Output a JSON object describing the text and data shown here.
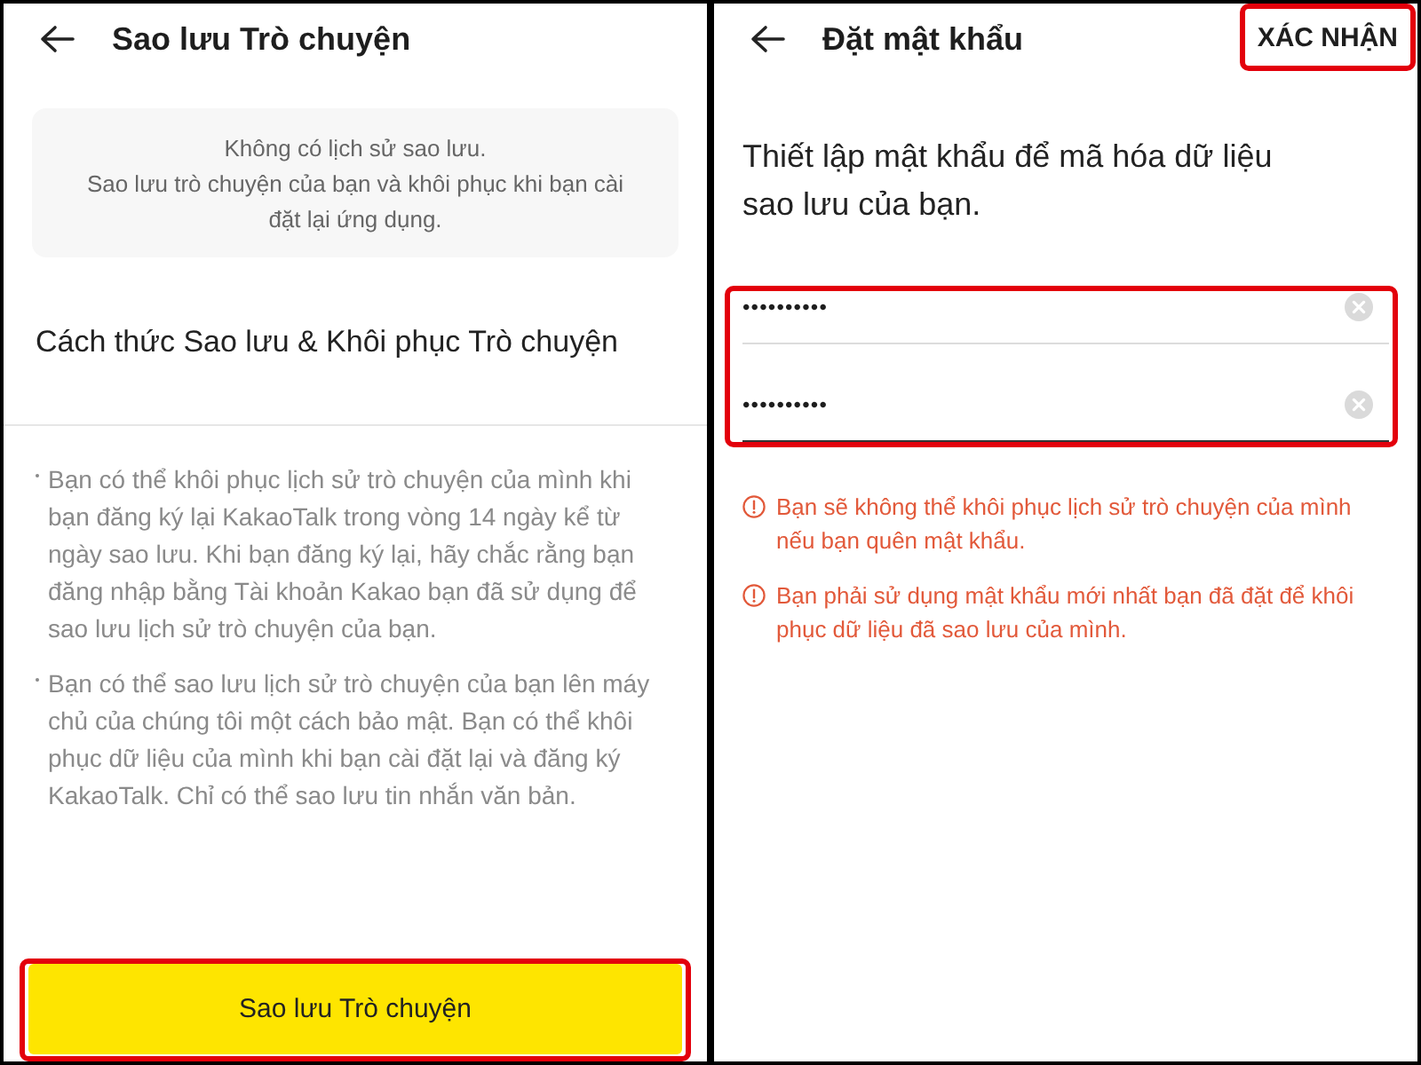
{
  "left_screen": {
    "header": {
      "title": "Sao lưu Trò chuyện"
    },
    "notice": {
      "title": "Không có lịch sử sao lưu.",
      "message": "Sao lưu trò chuyện của bạn và khôi phục khi bạn cài đặt lại ứng dụng."
    },
    "section_title": "Cách thức Sao lưu & Khôi phục Trò chuyện",
    "guide_items": [
      "Bạn có thể khôi phục lịch sử trò chuyện của mình khi bạn đăng ký lại KakaoTalk trong vòng 14 ngày kể từ ngày sao lưu. Khi bạn đăng ký lại, hãy chắc rằng bạn đăng nhập bằng Tài khoản Kakao bạn đã sử dụng để sao lưu lịch sử trò chuyện của bạn.",
      "Bạn có thể sao lưu lịch sử trò chuyện của bạn lên máy chủ của chúng tôi một cách bảo mật. Bạn có thể khôi phục dữ liệu của mình khi bạn cài đặt lại và đăng ký KakaoTalk. Chỉ có thể sao lưu tin nhắn văn bản."
    ],
    "backup_button": {
      "label": "Sao lưu Trò chuyện",
      "highlighted": true
    }
  },
  "right_screen": {
    "header": {
      "title": "Đặt mật khẩu"
    },
    "confirm_button": {
      "label": "XÁC NHẬN",
      "highlighted": true
    },
    "instruction": "Thiết lập mật khẩu để mã hóa dữ liệu sao lưu của bạn.",
    "password_fields": {
      "highlighted": true,
      "fields": [
        {
          "value": "••••••••••",
          "focused": false
        },
        {
          "value": "••••••••••",
          "focused": true
        }
      ]
    },
    "warnings": [
      "Bạn sẽ không thể khôi phục lịch sử trò chuyện của mình nếu bạn quên mật khẩu.",
      "Bạn phải sử dụng mật khẩu mới nhất bạn đã đặt để khôi phục dữ liệu đã sao lưu của mình."
    ]
  }
}
